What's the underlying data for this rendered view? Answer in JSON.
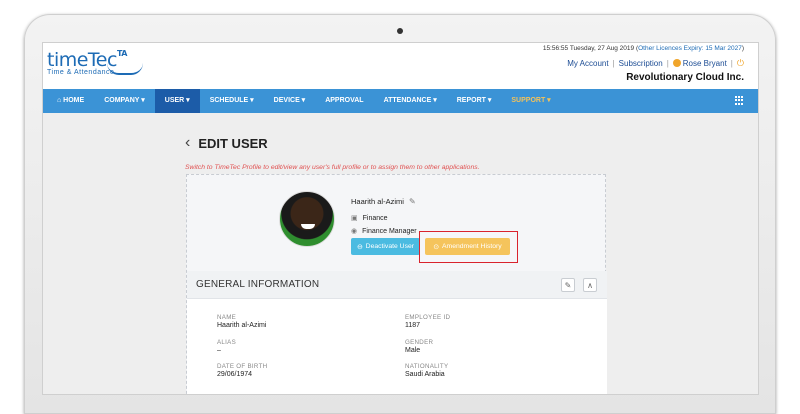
{
  "header": {
    "logo_text": "timeTec",
    "logo_badge": "TA",
    "logo_sub": "Time & Attendance",
    "datetime": "15:56:55 Tuesday, 27 Aug 2019 (",
    "licence_link": "Other Licences Expiry: 15 Mar 2027",
    "datetime_close": ")",
    "my_account": "My Account",
    "subscription": "Subscription",
    "user_name": "Rose Bryant",
    "separator": "|",
    "company": "Revolutionary Cloud Inc."
  },
  "nav": {
    "items": [
      {
        "label": "⌂ HOME"
      },
      {
        "label": "COMPANY ▾"
      },
      {
        "label": "USER ▾"
      },
      {
        "label": "SCHEDULE ▾"
      },
      {
        "label": "DEVICE ▾"
      },
      {
        "label": "APPROVAL"
      },
      {
        "label": "ATTENDANCE ▾"
      },
      {
        "label": "REPORT ▾"
      },
      {
        "label": "SUPPORT ▾"
      }
    ],
    "active_index": 2
  },
  "page": {
    "back_glyph": "‹",
    "title": "EDIT USER",
    "notice": "Switch to TimeTec Profile to edit/view any user's full profile or to assign them to other applications."
  },
  "profile": {
    "name": "Haarith al-Azimi",
    "department": "Finance",
    "position": "Finance Manager",
    "deactivate_label": "Deactivate User",
    "amendment_label": "Amendment History"
  },
  "general": {
    "title": "GENERAL INFORMATION",
    "fields": {
      "name_label": "NAME",
      "name_value": "Haarith al-Azimi",
      "employee_id_label": "EMPLOYEE ID",
      "employee_id_value": "1187",
      "alias_label": "ALIAS",
      "alias_value": "–",
      "gender_label": "GENDER",
      "gender_value": "Male",
      "dob_label": "DATE OF BIRTH",
      "dob_value": "29/06/1974",
      "nationality_label": "NATIONALITY",
      "nationality_value": "Saudi Arabia"
    }
  },
  "colors": {
    "nav_bg": "#3b93d6",
    "nav_active": "#1c5ca8",
    "deactivate": "#4bbbe1",
    "amendment": "#f5c45c",
    "highlight": "#d9232d",
    "notice": "#e05050"
  },
  "icons": [
    "home-icon",
    "pencil-icon",
    "briefcase-icon",
    "user-icon",
    "power-icon",
    "grid-icon",
    "chevron-up-icon",
    "back-icon"
  ]
}
